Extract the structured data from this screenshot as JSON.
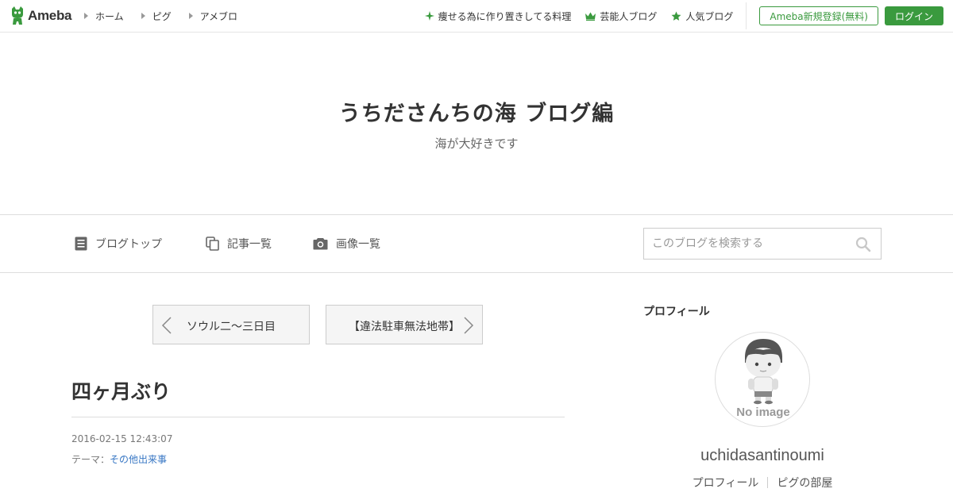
{
  "header": {
    "logo_text": "Ameba",
    "nav": [
      {
        "label": "ホーム"
      },
      {
        "label": "ピグ"
      },
      {
        "label": "アメブロ"
      }
    ],
    "right_links": [
      {
        "label": "痩せる為に作り置きしてる料理",
        "icon": "sparkle-icon"
      },
      {
        "label": "芸能人ブログ",
        "icon": "crown-icon"
      },
      {
        "label": "人気ブログ",
        "icon": "star-icon"
      }
    ],
    "register_label": "Ameba新規登録(無料)",
    "login_label": "ログイン"
  },
  "hero": {
    "title": "うちださんちの海 ブログ編",
    "description": "海が大好きです"
  },
  "blog_nav": {
    "top": "ブログトップ",
    "entries": "記事一覧",
    "images": "画像一覧",
    "search_placeholder": "このブログを検索する"
  },
  "article": {
    "prev_title": "ソウル二～三日目",
    "next_title": "【違法駐車無法地帯】",
    "title": "四ヶ月ぶり",
    "date": "2016-02-15 12:43:07",
    "theme_label": "テーマ：",
    "theme_value": "その他出来事"
  },
  "sidebar": {
    "heading": "プロフィール",
    "no_image": "No image",
    "username": "uchidasantinoumi",
    "links": [
      {
        "label": "プロフィール"
      },
      {
        "label": "ピグの部屋"
      }
    ]
  },
  "colors": {
    "brand_green": "#3a9a3e",
    "link_blue": "#3877c4"
  }
}
